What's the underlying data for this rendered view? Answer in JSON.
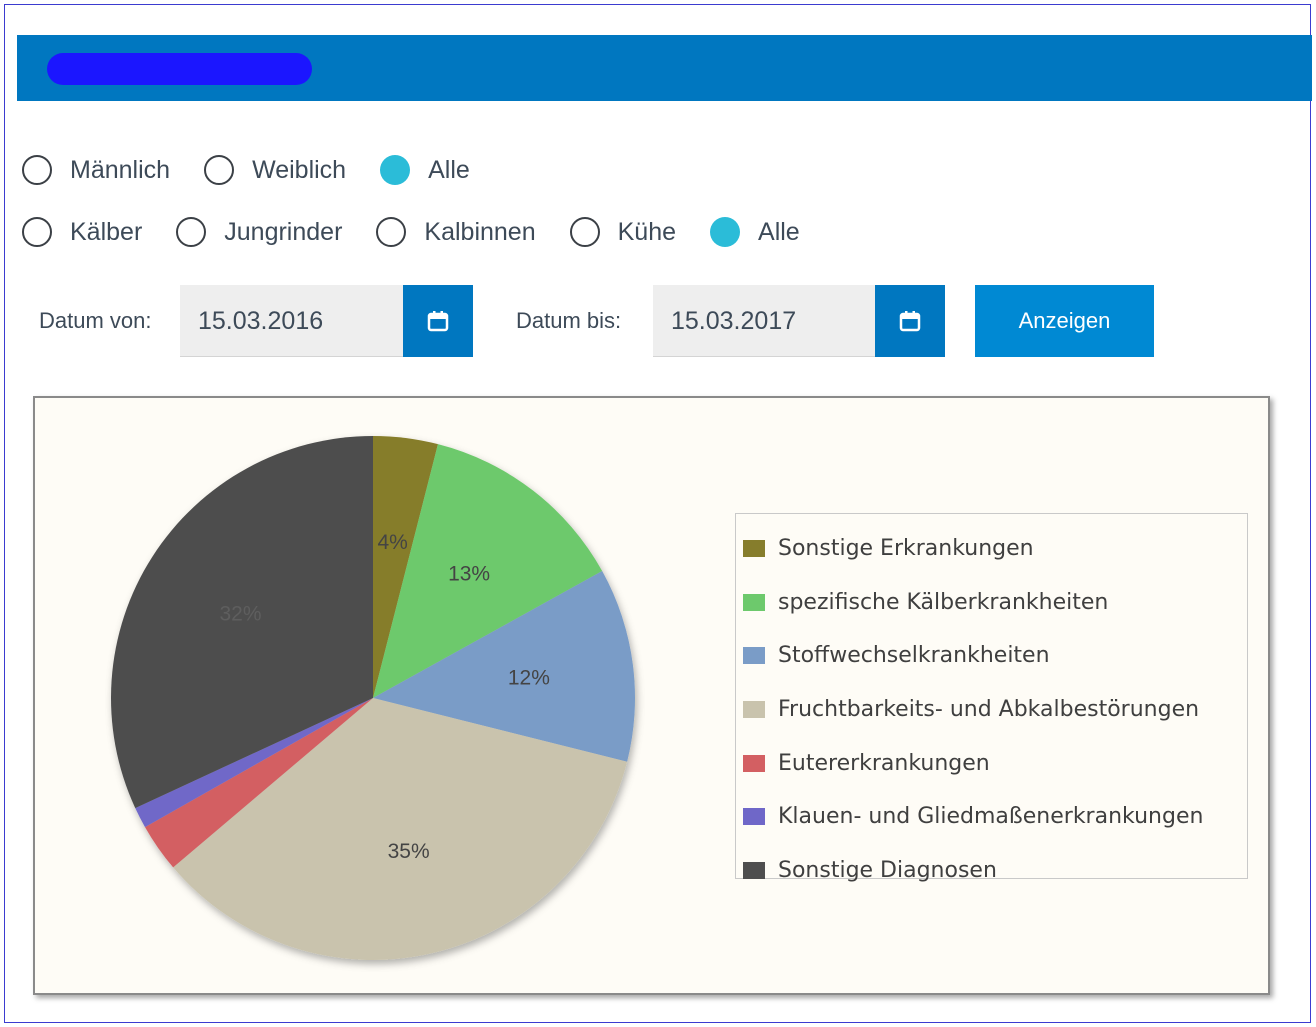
{
  "header": {
    "title": ""
  },
  "gender_filter": {
    "options": [
      {
        "label": "Männlich",
        "checked": false
      },
      {
        "label": "Weiblich",
        "checked": false
      },
      {
        "label": "Alle",
        "checked": true
      }
    ]
  },
  "category_filter": {
    "options": [
      {
        "label": "Kälber",
        "checked": false
      },
      {
        "label": "Jungrinder",
        "checked": false
      },
      {
        "label": "Kalbinnen",
        "checked": false
      },
      {
        "label": "Kühe",
        "checked": false
      },
      {
        "label": "Alle",
        "checked": true
      }
    ]
  },
  "dates": {
    "from_label": "Datum von:",
    "from_value": "15.03.2016",
    "to_label": "Datum bis:",
    "to_value": "15.03.2017",
    "calendar_icon": "calendar-icon",
    "show_button": "Anzeigen"
  },
  "colors": {
    "header": "#0077c0",
    "accent": "#2bbcd8",
    "button": "#0089d3"
  },
  "chart_data": {
    "type": "pie",
    "title": "",
    "legend_position": "right",
    "slices": [
      {
        "label": "Sonstige Erkrankungen",
        "value": 4,
        "color": "#867d2c",
        "data_label": "4%"
      },
      {
        "label": "spezifische Kälberkrankheiten",
        "value": 13,
        "color": "#6dc96c",
        "data_label": "13%"
      },
      {
        "label": "Stoffwechselkrankheiten",
        "value": 12,
        "color": "#7a9cc7",
        "data_label": "12%"
      },
      {
        "label": "Fruchtbarkeits- und Abkalbestörungen",
        "value": 35,
        "color": "#c9c3ad",
        "data_label": "35%"
      },
      {
        "label": "Eutererkrankungen",
        "value": 3,
        "color": "#d35f62",
        "data_label": ""
      },
      {
        "label": "Klauen- und Gliedmaßenerkrankungen",
        "value": 1.3,
        "color": "#6f67c8",
        "data_label": ""
      },
      {
        "label": "Sonstige Diagnosen",
        "value": 32,
        "color": "#4e4e4e",
        "data_label": "32%"
      }
    ]
  }
}
